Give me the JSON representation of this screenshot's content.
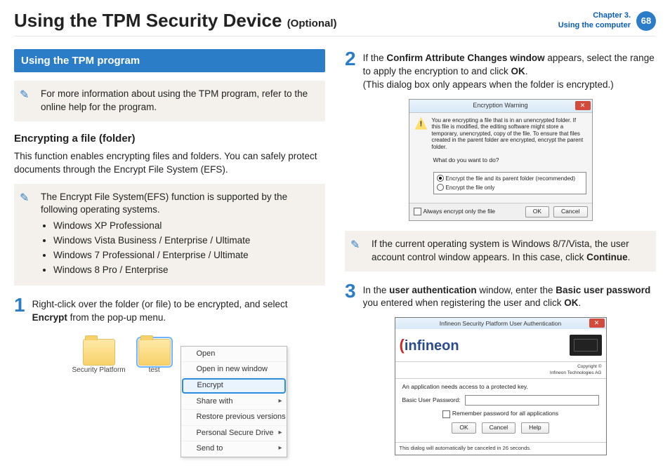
{
  "header": {
    "title_main": "Using the TPM Security Device",
    "title_optional": "(Optional)",
    "chapter_line1": "Chapter 3.",
    "chapter_line2": "Using the computer",
    "page_number": "68"
  },
  "section_bar": "Using the TPM program",
  "note1": "For more information about using the TPM program, refer to the online help for the program.",
  "subhead_encrypt": "Encrypting a file (folder)",
  "encrypt_desc": "This function enables encrypting files and folders. You can safely protect documents through the Encrypt File System (EFS).",
  "note2_intro": "The Encrypt File System(EFS) function is supported by the following operating systems.",
  "os_list": [
    "Windows XP Professional",
    "Windows Vista Business / Enterprise / Ultimate",
    "Windows 7 Professional / Enterprise / Ultimate",
    "Windows 8 Pro / Enterprise"
  ],
  "step1": {
    "num": "1",
    "pre": "Right-click over the folder (or file) to be encrypted, and select ",
    "bold": "Encrypt",
    "post": " from the pop-up menu."
  },
  "folders": {
    "a": "Security Platform",
    "b": "test"
  },
  "ctx": {
    "open": "Open",
    "new_window": "Open in new window",
    "encrypt": "Encrypt",
    "share": "Share with",
    "restore": "Restore previous versions",
    "psd": "Personal Secure Drive",
    "sendto": "Send to"
  },
  "step2": {
    "num": "2",
    "t1": "If the ",
    "b1": "Confirm Attribute Changes window",
    "t2": " appears, select the range to apply the encryption to and click ",
    "b2": "OK",
    "t3": ".",
    "note_line": "(This dialog box only appears when the folder is encrypted.)"
  },
  "dlg_warn": {
    "title": "Encryption Warning",
    "msg": "You are encrypting a file that is in an unencrypted folder. If this file is modified, the editing software might store a temporary, unencrypted, copy of the file. To ensure that files created in the parent folder are encrypted, encrypt the parent folder.",
    "question": "What do you want to do?",
    "opt1": "Encrypt the file and its parent folder (recommended)",
    "opt2": "Encrypt the file only",
    "always": "Always encrypt only the file",
    "ok": "OK",
    "cancel": "Cancel"
  },
  "note3": {
    "t1": "If the current operating system is Windows 8/7/Vista, the user account control window appears. In this case, click ",
    "b1": "Continue",
    "t2": "."
  },
  "step3": {
    "num": "3",
    "t1": "In the ",
    "b1": "user authentication",
    "t2": " window, enter the ",
    "b2": "Basic user password",
    "t3": " you entered when registering the user and click ",
    "b3": "OK",
    "t4": "."
  },
  "dlg_auth": {
    "title": "Infineon Security Platform User Authentication",
    "brand_pre": "(",
    "brand": "infineon",
    "cop1": "Copyright ©",
    "cop2": "Infineon Technologies AG",
    "msg": "An application needs access to a protected key.",
    "label": "Basic User Password:",
    "remember": "Remember password for all applications",
    "ok": "OK",
    "cancel": "Cancel",
    "help": "Help",
    "foot": "This dialog will automatically be canceled in 26 seconds."
  }
}
